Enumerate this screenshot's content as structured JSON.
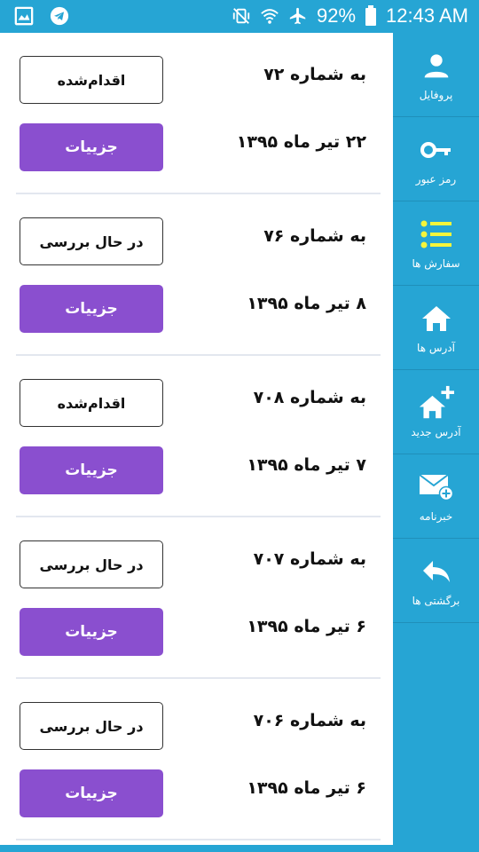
{
  "status_bar": {
    "left_icons": [
      "gallery-icon",
      "telegram-icon"
    ],
    "right_icons": [
      "vibrate-mute-icon",
      "wifi-icon",
      "airplane-mode-icon"
    ],
    "battery": "92%",
    "time": "12:43 AM"
  },
  "orders": [
    {
      "number": "به شماره ۷۲",
      "date": "۲۲ تیر ماه ۱۳۹۵",
      "status": "اقدام‌شده",
      "details_label": "جزییات"
    },
    {
      "number": "به شماره ۷۶",
      "date": "۸ تیر ماه ۱۳۹۵",
      "status": "در حال بررسی",
      "details_label": "جزییات"
    },
    {
      "number": "به شماره ۷۰۸",
      "date": "۷ تیر ماه ۱۳۹۵",
      "status": "اقدام‌شده",
      "details_label": "جزییات"
    },
    {
      "number": "به شماره ۷۰۷",
      "date": "۶ تیر ماه ۱۳۹۵",
      "status": "در حال بررسی",
      "details_label": "جزییات"
    },
    {
      "number": "به شماره ۷۰۶",
      "date": "۶ تیر ماه ۱۳۹۵",
      "status": "در حال بررسی",
      "details_label": "جزییات"
    }
  ],
  "sidebar": {
    "items": [
      {
        "label": "پروفایل",
        "icon": "person-icon"
      },
      {
        "label": "رمز عبور",
        "icon": "key-icon"
      },
      {
        "label": "سفارش ها",
        "icon": "list-icon"
      },
      {
        "label": "آدرس ها",
        "icon": "home-icon"
      },
      {
        "label": "آدرس جدید",
        "icon": "add-home-icon"
      },
      {
        "label": "خبرنامه",
        "icon": "mail-add-icon"
      },
      {
        "label": "برگشتی ها",
        "icon": "reply-icon"
      }
    ]
  },
  "colors": {
    "primary": "#26a5d4",
    "details_button": "#8a4fcf",
    "orders_icon_accent": "#f5f53b"
  }
}
